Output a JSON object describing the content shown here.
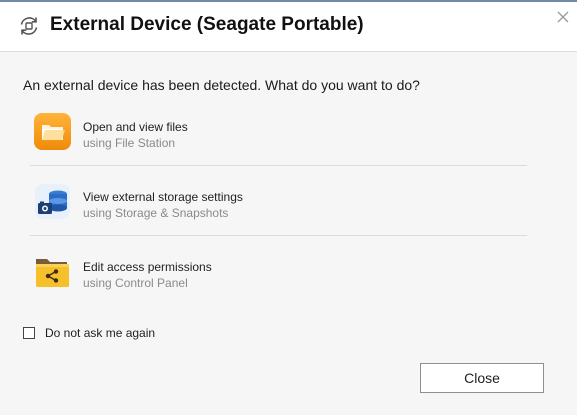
{
  "dialog": {
    "title": "External Device (Seagate Portable)",
    "question": "An external device has been detected. What do you want to do?",
    "options": [
      {
        "label": "Open and view files",
        "sub": "using File Station",
        "icon": "file-station-folder-icon"
      },
      {
        "label": "View external storage settings",
        "sub": "using Storage & Snapshots",
        "icon": "storage-snapshots-icon"
      },
      {
        "label": "Edit access permissions",
        "sub": "using Control Panel",
        "icon": "shared-folder-icon"
      }
    ],
    "checkbox_label": "Do not ask me again",
    "checkbox_checked": false,
    "close_button": "Close"
  },
  "colors": {
    "accent_orange": "#f7a21b",
    "storage_blue": "#2b6cc4",
    "folder_yellow": "#f5c02a"
  }
}
